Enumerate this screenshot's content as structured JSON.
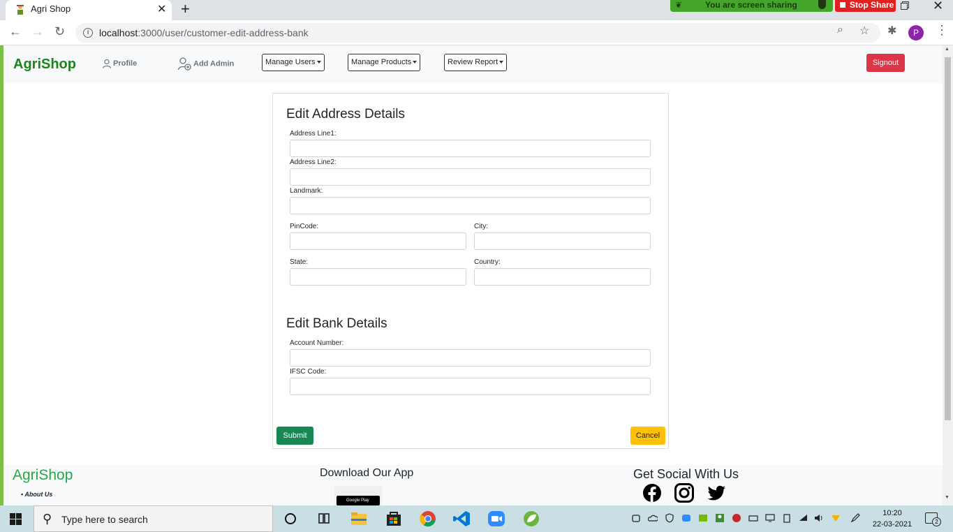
{
  "browser": {
    "tab_title": "Agri Shop",
    "tab_close": "✕",
    "new_tab": "+",
    "url_host": "localhost",
    "url_path": ":3000/user/customer-edit-address-bank",
    "profile_initial": "P",
    "screen_share_text": "You are screen sharing",
    "stop_share_label": "Stop Share",
    "window_close": "✕"
  },
  "navbar": {
    "brand": "AgriShop",
    "profile_label": "Profile",
    "add_admin_label": "Add Admin",
    "manage_users_label": "Manage Users",
    "manage_products_label": "Manage Products",
    "review_report_label": "Review Report",
    "signout_label": "Signout"
  },
  "address_form": {
    "title": "Edit Address Details",
    "address_line1_label": "Address Line1:",
    "address_line1_value": "",
    "address_line2_label": "Address Line2:",
    "address_line2_value": "",
    "landmark_label": "Landmark:",
    "landmark_value": "",
    "pincode_label": "PinCode:",
    "pincode_value": "",
    "city_label": "City:",
    "city_value": "",
    "state_label": "State:",
    "state_value": "",
    "country_label": "Country:",
    "country_value": ""
  },
  "bank_form": {
    "title": "Edit Bank Details",
    "account_number_label": "Account Number:",
    "account_number_value": "",
    "ifsc_label": "IFSC Code:",
    "ifsc_value": ""
  },
  "actions": {
    "submit_label": "Submit",
    "cancel_label": "Cancel"
  },
  "footer": {
    "brand": "AgriShop",
    "about_label": "About Us",
    "download_title": "Download Our App",
    "google_play_label": "Google Play",
    "social_title": "Get Social With Us",
    "social_icons": [
      "facebook-icon",
      "instagram-icon",
      "twitter-icon"
    ]
  },
  "taskbar": {
    "search_placeholder": "Type here to search",
    "time": "10:20",
    "date": "22-03-2021",
    "notification_count": "2",
    "apps": [
      "cortana-icon",
      "task-view-icon",
      "file-explorer-icon",
      "store-icon",
      "chrome-icon",
      "vscode-icon",
      "zoom-icon",
      "spring-tool-icon"
    ]
  },
  "colors": {
    "brand_green": "#198718",
    "footer_green": "#28a745",
    "signout_red": "#dc3545",
    "submit_green": "#198754",
    "cancel_yellow": "#ffc107",
    "share_green": "#7ac143"
  }
}
